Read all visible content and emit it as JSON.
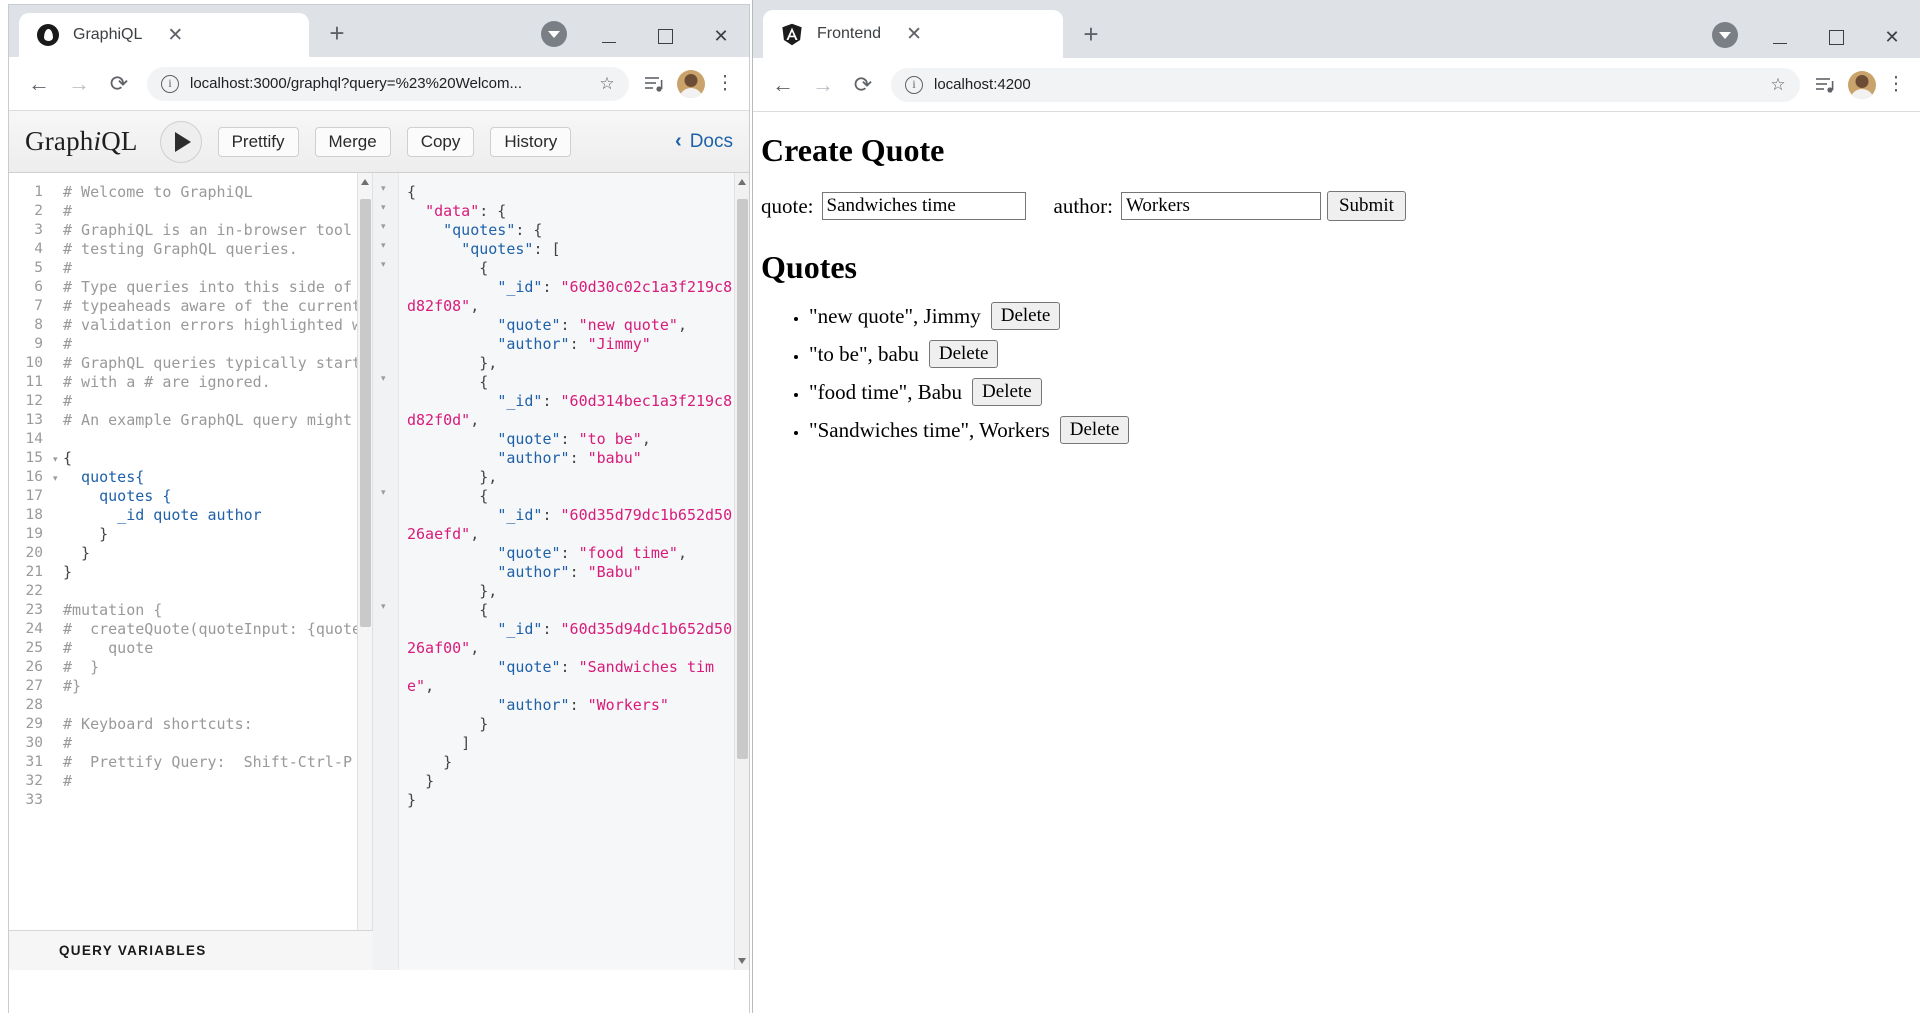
{
  "left_window": {
    "tab": {
      "title": "GraphiQL",
      "favicon": "graphiql-logo-icon",
      "close": "✕"
    },
    "new_tab": "+",
    "profile_caret": "▼",
    "controls": {
      "minimize": "minimize-icon",
      "maximize": "maximize-icon",
      "close": "close-icon"
    },
    "toolbar": {
      "back": "←",
      "forward": "→",
      "reload": "⟳",
      "info": "i",
      "url": "localhost:3000/graphql?query=%23%20Welcom...",
      "star": "☆",
      "reading_list": "reading-list-icon",
      "menu": "⋮"
    },
    "graphiql": {
      "logo_a": "Graph",
      "logo_i": "i",
      "logo_b": "QL",
      "execute": "execute-query-button",
      "buttons": [
        "Prettify",
        "Merge",
        "Copy",
        "History"
      ],
      "docs_label": "Docs",
      "docs_chevron": "‹",
      "query_variables_label": "QUERY VARIABLES",
      "editor_lines": [
        {
          "n": 1,
          "fold": "",
          "segs": [
            {
              "t": "# Welcome to GraphiQL",
              "c": "tk-com"
            }
          ]
        },
        {
          "n": 2,
          "fold": "",
          "segs": [
            {
              "t": "#",
              "c": "tk-com"
            }
          ]
        },
        {
          "n": 3,
          "fold": "",
          "segs": [
            {
              "t": "# GraphiQL is an in-browser tool",
              "c": "tk-com"
            }
          ]
        },
        {
          "n": 4,
          "fold": "",
          "segs": [
            {
              "t": "# testing GraphQL queries.",
              "c": "tk-com"
            }
          ]
        },
        {
          "n": 5,
          "fold": "",
          "segs": [
            {
              "t": "#",
              "c": "tk-com"
            }
          ]
        },
        {
          "n": 6,
          "fold": "",
          "segs": [
            {
              "t": "# Type queries into this side of",
              "c": "tk-com"
            }
          ]
        },
        {
          "n": 7,
          "fold": "",
          "segs": [
            {
              "t": "# typeaheads aware of the current",
              "c": "tk-com"
            }
          ]
        },
        {
          "n": 8,
          "fold": "",
          "segs": [
            {
              "t": "# validation errors highlighted w",
              "c": "tk-com"
            }
          ]
        },
        {
          "n": 9,
          "fold": "",
          "segs": [
            {
              "t": "#",
              "c": "tk-com"
            }
          ]
        },
        {
          "n": 10,
          "fold": "",
          "segs": [
            {
              "t": "# GraphQL queries typically start",
              "c": "tk-com"
            }
          ]
        },
        {
          "n": 11,
          "fold": "",
          "segs": [
            {
              "t": "# with a # are ignored.",
              "c": "tk-com"
            }
          ]
        },
        {
          "n": 12,
          "fold": "",
          "segs": [
            {
              "t": "#",
              "c": "tk-com"
            }
          ]
        },
        {
          "n": 13,
          "fold": "",
          "segs": [
            {
              "t": "# An example GraphQL query might",
              "c": "tk-com"
            }
          ]
        },
        {
          "n": 14,
          "fold": "",
          "segs": [
            {
              "t": "",
              "c": "tk-pn"
            }
          ]
        },
        {
          "n": 15,
          "fold": "▾",
          "segs": [
            {
              "t": "{",
              "c": "tk-pn"
            }
          ]
        },
        {
          "n": 16,
          "fold": "▾",
          "segs": [
            {
              "t": "  quotes{",
              "c": "tk-kw"
            }
          ]
        },
        {
          "n": 17,
          "fold": "",
          "segs": [
            {
              "t": "    quotes {",
              "c": "tk-kw"
            }
          ]
        },
        {
          "n": 18,
          "fold": "",
          "segs": [
            {
              "t": "      _id quote author",
              "c": "tk-kw"
            }
          ]
        },
        {
          "n": 19,
          "fold": "",
          "segs": [
            {
              "t": "    }",
              "c": "tk-pn"
            }
          ]
        },
        {
          "n": 20,
          "fold": "",
          "segs": [
            {
              "t": "  }",
              "c": "tk-pn"
            }
          ]
        },
        {
          "n": 21,
          "fold": "",
          "segs": [
            {
              "t": "}",
              "c": "tk-pn"
            }
          ]
        },
        {
          "n": 22,
          "fold": "",
          "segs": [
            {
              "t": "",
              "c": "tk-pn"
            }
          ]
        },
        {
          "n": 23,
          "fold": "",
          "segs": [
            {
              "t": "#mutation {",
              "c": "tk-com"
            }
          ]
        },
        {
          "n": 24,
          "fold": "",
          "segs": [
            {
              "t": "#  createQuote(quoteInput: {quote",
              "c": "tk-com"
            }
          ]
        },
        {
          "n": 25,
          "fold": "",
          "segs": [
            {
              "t": "#    quote",
              "c": "tk-com"
            }
          ]
        },
        {
          "n": 26,
          "fold": "",
          "segs": [
            {
              "t": "#  }",
              "c": "tk-com"
            }
          ]
        },
        {
          "n": 27,
          "fold": "",
          "segs": [
            {
              "t": "#}",
              "c": "tk-com"
            }
          ]
        },
        {
          "n": 28,
          "fold": "",
          "segs": [
            {
              "t": "",
              "c": "tk-pn"
            }
          ]
        },
        {
          "n": 29,
          "fold": "",
          "segs": [
            {
              "t": "# Keyboard shortcuts:",
              "c": "tk-com"
            }
          ]
        },
        {
          "n": 30,
          "fold": "",
          "segs": [
            {
              "t": "#",
              "c": "tk-com"
            }
          ]
        },
        {
          "n": 31,
          "fold": "",
          "segs": [
            {
              "t": "#  Prettify Query:  Shift-Ctrl-P",
              "c": "tk-com"
            }
          ]
        },
        {
          "n": 32,
          "fold": "",
          "segs": [
            {
              "t": "#",
              "c": "tk-com"
            }
          ]
        },
        {
          "n": 33,
          "fold": "",
          "segs": [
            {
              "t": "",
              "c": "tk-com"
            }
          ]
        }
      ],
      "result_lines": [
        {
          "fold": "▾",
          "segs": [
            {
              "t": "{",
              "c": "j-pn"
            }
          ]
        },
        {
          "fold": "▾",
          "segs": [
            {
              "t": "  ",
              "c": "j-pn"
            },
            {
              "t": "\"data\"",
              "c": "j-data"
            },
            {
              "t": ": {",
              "c": "j-pn"
            }
          ]
        },
        {
          "fold": "▾",
          "segs": [
            {
              "t": "    ",
              "c": "j-pn"
            },
            {
              "t": "\"quotes\"",
              "c": "j-key"
            },
            {
              "t": ": {",
              "c": "j-pn"
            }
          ]
        },
        {
          "fold": "▾",
          "segs": [
            {
              "t": "      ",
              "c": "j-pn"
            },
            {
              "t": "\"quotes\"",
              "c": "j-key"
            },
            {
              "t": ": [",
              "c": "j-pn"
            }
          ]
        },
        {
          "fold": "▾",
          "segs": [
            {
              "t": "        {",
              "c": "j-pn"
            }
          ]
        },
        {
          "fold": "",
          "segs": [
            {
              "t": "          ",
              "c": "j-pn"
            },
            {
              "t": "\"_id\"",
              "c": "j-key"
            },
            {
              "t": ": ",
              "c": "j-pn"
            },
            {
              "t": "\"60d30c02c1a3f219c8d82f08\"",
              "c": "j-str"
            },
            {
              "t": ",",
              "c": "j-pn"
            }
          ]
        },
        {
          "fold": "",
          "segs": [
            {
              "t": "          ",
              "c": "j-pn"
            },
            {
              "t": "\"quote\"",
              "c": "j-key"
            },
            {
              "t": ": ",
              "c": "j-pn"
            },
            {
              "t": "\"new quote\"",
              "c": "j-str"
            },
            {
              "t": ",",
              "c": "j-pn"
            }
          ]
        },
        {
          "fold": "",
          "segs": [
            {
              "t": "          ",
              "c": "j-pn"
            },
            {
              "t": "\"author\"",
              "c": "j-key"
            },
            {
              "t": ": ",
              "c": "j-pn"
            },
            {
              "t": "\"Jimmy\"",
              "c": "j-str"
            }
          ]
        },
        {
          "fold": "",
          "segs": [
            {
              "t": "        },",
              "c": "j-pn"
            }
          ]
        },
        {
          "fold": "▾",
          "segs": [
            {
              "t": "        {",
              "c": "j-pn"
            }
          ]
        },
        {
          "fold": "",
          "segs": [
            {
              "t": "          ",
              "c": "j-pn"
            },
            {
              "t": "\"_id\"",
              "c": "j-key"
            },
            {
              "t": ": ",
              "c": "j-pn"
            },
            {
              "t": "\"60d314bec1a3f219c8d82f0d\"",
              "c": "j-str"
            },
            {
              "t": ",",
              "c": "j-pn"
            }
          ]
        },
        {
          "fold": "",
          "segs": [
            {
              "t": "          ",
              "c": "j-pn"
            },
            {
              "t": "\"quote\"",
              "c": "j-key"
            },
            {
              "t": ": ",
              "c": "j-pn"
            },
            {
              "t": "\"to be\"",
              "c": "j-str"
            },
            {
              "t": ",",
              "c": "j-pn"
            }
          ]
        },
        {
          "fold": "",
          "segs": [
            {
              "t": "          ",
              "c": "j-pn"
            },
            {
              "t": "\"author\"",
              "c": "j-key"
            },
            {
              "t": ": ",
              "c": "j-pn"
            },
            {
              "t": "\"babu\"",
              "c": "j-str"
            }
          ]
        },
        {
          "fold": "",
          "segs": [
            {
              "t": "        },",
              "c": "j-pn"
            }
          ]
        },
        {
          "fold": "▾",
          "segs": [
            {
              "t": "        {",
              "c": "j-pn"
            }
          ]
        },
        {
          "fold": "",
          "segs": [
            {
              "t": "          ",
              "c": "j-pn"
            },
            {
              "t": "\"_id\"",
              "c": "j-key"
            },
            {
              "t": ": ",
              "c": "j-pn"
            },
            {
              "t": "\"60d35d79dc1b652d5026aefd\"",
              "c": "j-str"
            },
            {
              "t": ",",
              "c": "j-pn"
            }
          ]
        },
        {
          "fold": "",
          "segs": [
            {
              "t": "          ",
              "c": "j-pn"
            },
            {
              "t": "\"quote\"",
              "c": "j-key"
            },
            {
              "t": ": ",
              "c": "j-pn"
            },
            {
              "t": "\"food time\"",
              "c": "j-str"
            },
            {
              "t": ",",
              "c": "j-pn"
            }
          ]
        },
        {
          "fold": "",
          "segs": [
            {
              "t": "          ",
              "c": "j-pn"
            },
            {
              "t": "\"author\"",
              "c": "j-key"
            },
            {
              "t": ": ",
              "c": "j-pn"
            },
            {
              "t": "\"Babu\"",
              "c": "j-str"
            }
          ]
        },
        {
          "fold": "",
          "segs": [
            {
              "t": "        },",
              "c": "j-pn"
            }
          ]
        },
        {
          "fold": "▾",
          "segs": [
            {
              "t": "        {",
              "c": "j-pn"
            }
          ]
        },
        {
          "fold": "",
          "segs": [
            {
              "t": "          ",
              "c": "j-pn"
            },
            {
              "t": "\"_id\"",
              "c": "j-key"
            },
            {
              "t": ": ",
              "c": "j-pn"
            },
            {
              "t": "\"60d35d94dc1b652d5026af00\"",
              "c": "j-str"
            },
            {
              "t": ",",
              "c": "j-pn"
            }
          ]
        },
        {
          "fold": "",
          "segs": [
            {
              "t": "          ",
              "c": "j-pn"
            },
            {
              "t": "\"quote\"",
              "c": "j-key"
            },
            {
              "t": ": ",
              "c": "j-pn"
            },
            {
              "t": "\"Sandwiches time\"",
              "c": "j-str"
            },
            {
              "t": ",",
              "c": "j-pn"
            }
          ]
        },
        {
          "fold": "",
          "segs": [
            {
              "t": "          ",
              "c": "j-pn"
            },
            {
              "t": "\"author\"",
              "c": "j-key"
            },
            {
              "t": ": ",
              "c": "j-pn"
            },
            {
              "t": "\"Workers\"",
              "c": "j-str"
            }
          ]
        },
        {
          "fold": "",
          "segs": [
            {
              "t": "        }",
              "c": "j-pn"
            }
          ]
        },
        {
          "fold": "",
          "segs": [
            {
              "t": "      ]",
              "c": "j-pn"
            }
          ]
        },
        {
          "fold": "",
          "segs": [
            {
              "t": "    }",
              "c": "j-pn"
            }
          ]
        },
        {
          "fold": "",
          "segs": [
            {
              "t": "  }",
              "c": "j-pn"
            }
          ]
        },
        {
          "fold": "",
          "segs": [
            {
              "t": "}",
              "c": "j-pn"
            }
          ]
        }
      ]
    }
  },
  "right_window": {
    "tab": {
      "title": "Frontend",
      "favicon": "angular-logo-icon",
      "close": "✕"
    },
    "new_tab": "+",
    "profile_caret": "▼",
    "controls": {
      "minimize": "minimize-icon",
      "maximize": "maximize-icon",
      "close": "close-icon"
    },
    "toolbar": {
      "back": "←",
      "forward": "→",
      "reload": "⟳",
      "info": "i",
      "url": "localhost:4200",
      "star": "☆",
      "reading_list": "reading-list-icon",
      "menu": "⋮"
    },
    "page": {
      "create_heading": "Create Quote",
      "quote_label": "quote:",
      "quote_value": "Sandwiches time",
      "author_label": "author:",
      "author_value": "Workers",
      "submit_label": "Submit",
      "quotes_heading": "Quotes",
      "delete_label": "Delete",
      "quotes": [
        {
          "text": "\"new quote\", Jimmy"
        },
        {
          "text": "\"to be\", babu"
        },
        {
          "text": "\"food time\", Babu"
        },
        {
          "text": "\"Sandwiches time\", Workers"
        }
      ]
    }
  },
  "colors": {
    "chrome_tabstrip": "#dee1e6",
    "graphql_pink": "#d81b7b",
    "graphql_blue": "#1f61a9",
    "comment_gray": "#999999",
    "angular_dark": "#1a1a1a"
  }
}
